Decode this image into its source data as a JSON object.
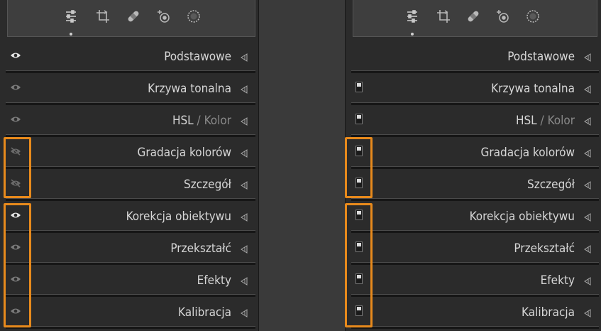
{
  "colors": {
    "panel_bg": "#2b2b2b",
    "gap_bg": "#3a3a3a",
    "highlight": "#e88a1c",
    "text": "#d6d6d6",
    "text_dim": "#8a8a8a"
  },
  "toolstrip": {
    "tools": [
      {
        "icon": "sliders-icon",
        "active": true
      },
      {
        "icon": "crop-icon",
        "active": false
      },
      {
        "icon": "bandage-icon",
        "active": false
      },
      {
        "icon": "red-eye-icon",
        "active": false
      },
      {
        "icon": "mask-icon",
        "active": false
      }
    ]
  },
  "left_panel": {
    "sections": [
      {
        "label": "Podstawowe",
        "visibility": "visible-bright"
      },
      {
        "label": "Krzywa tonalna",
        "visibility": "visible-dim"
      },
      {
        "label_main": "HSL",
        "label_sep": "/",
        "label_dim": "Kolor",
        "visibility": "visible-dim"
      },
      {
        "label": "Gradacja kolorów",
        "visibility": "hidden"
      },
      {
        "label": "Szczegół",
        "visibility": "hidden"
      },
      {
        "label": "Korekcja obiektywu",
        "visibility": "visible-bright"
      },
      {
        "label": "Przekształć",
        "visibility": "visible-dim"
      },
      {
        "label": "Efekty",
        "visibility": "visible-dim"
      },
      {
        "label": "Kalibracja",
        "visibility": "visible-dim"
      }
    ]
  },
  "right_panel": {
    "sections": [
      {
        "label": "Podstawowe",
        "switch": "none"
      },
      {
        "label": "Krzywa tonalna",
        "switch": "on"
      },
      {
        "label_main": "HSL",
        "label_sep": "/",
        "label_dim": "Kolor",
        "switch": "on"
      },
      {
        "label": "Gradacja kolorów",
        "switch": "on"
      },
      {
        "label": "Szczegół",
        "switch": "on"
      },
      {
        "label": "Korekcja obiektywu",
        "switch": "on"
      },
      {
        "label": "Przekształć",
        "switch": "on"
      },
      {
        "label": "Efekty",
        "switch": "on"
      },
      {
        "label": "Kalibracja",
        "switch": "on"
      }
    ]
  }
}
